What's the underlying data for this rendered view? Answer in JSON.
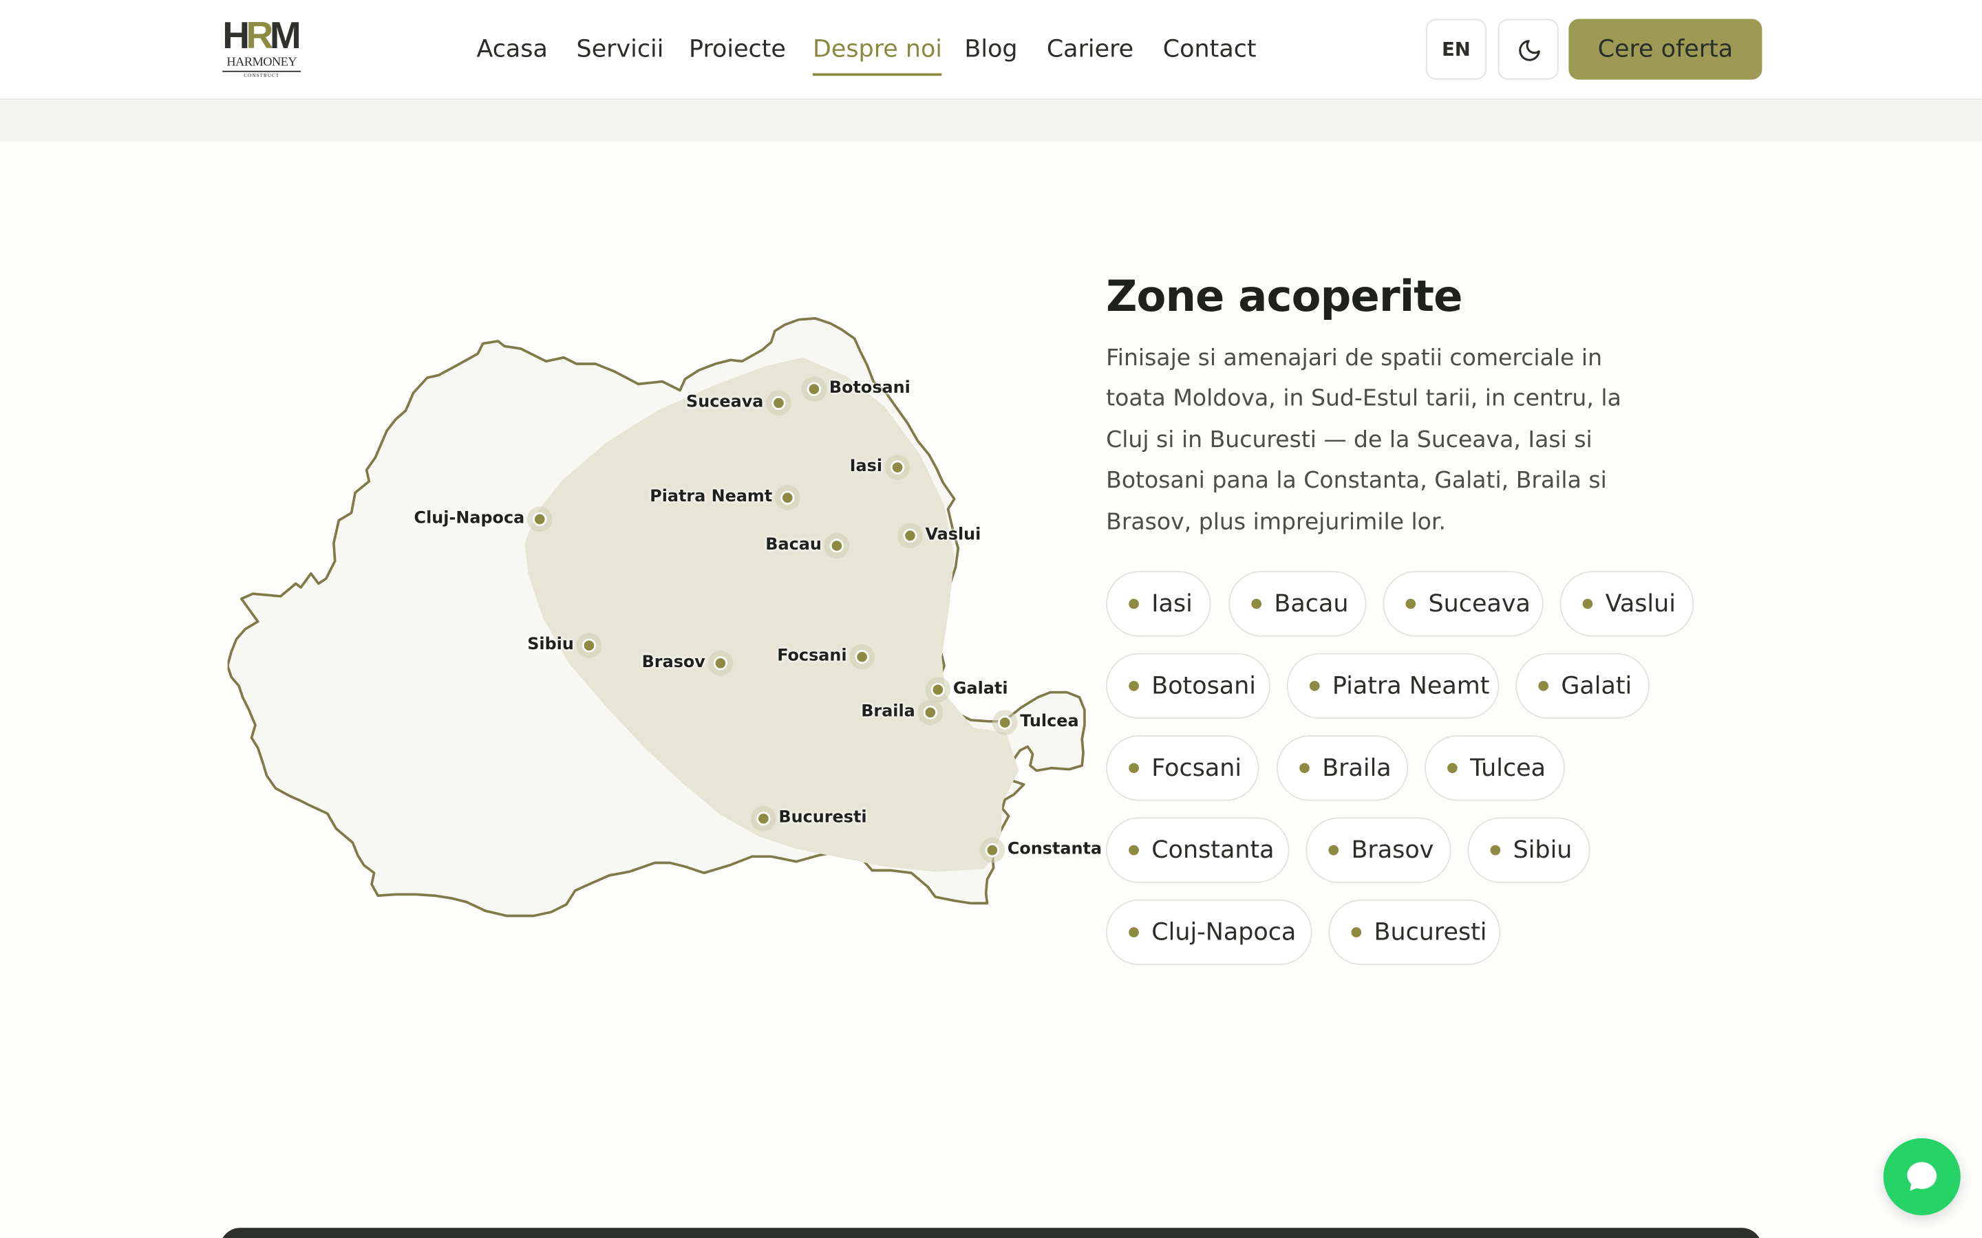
{
  "logo": {
    "mark_h": "H",
    "mark_r": "R",
    "mark_m": "M",
    "name": "HARMONEY",
    "tagline": "CONSTRUCT"
  },
  "nav": {
    "items": [
      {
        "label": "Acasa",
        "active": false
      },
      {
        "label": "Servicii",
        "active": false
      },
      {
        "label": "Proiecte",
        "active": false
      },
      {
        "label": "Despre noi",
        "active": true
      },
      {
        "label": "Blog",
        "active": false
      },
      {
        "label": "Cariere",
        "active": false
      },
      {
        "label": "Contact",
        "active": false
      }
    ],
    "lang_label": "EN",
    "theme_icon": "moon-icon",
    "cta_label": "Cere oferta"
  },
  "colors": {
    "accent": "#8a8a3f",
    "cta_bg": "#9c9a55",
    "map_fill": "#f8f8f3",
    "coverage_fill": "#e6e5d6",
    "chat": "#25d366"
  },
  "coverage": {
    "title": "Zone acoperite",
    "description": "Finisaje si amenajari de spatii comerciale in toata Moldova, in Sud-Estul tarii, in centru, la Cluj si in Bucuresti — de la Suceava, Iasi si Botosani pana la Constanta, Galati, Braila si Brasov, plus imprejurimile lor.",
    "cities": [
      "Iasi",
      "Bacau",
      "Suceava",
      "Vaslui",
      "Botosani",
      "Piatra Neamt",
      "Galati",
      "Focsani",
      "Braila",
      "Tulcea",
      "Constanta",
      "Brasov",
      "Sibiu",
      "Cluj-Napoca",
      "Bucuresti"
    ]
  },
  "map_labels": {
    "botosani": "Botosani",
    "suceava": "Suceava",
    "iasi": "Iasi",
    "piatra": "Piatra Neamt",
    "cluj": "Cluj-Napoca",
    "bacau": "Bacau",
    "vaslui": "Vaslui",
    "sibiu": "Sibiu",
    "brasov": "Brasov",
    "focsani": "Focsani",
    "galati": "Galati",
    "braila": "Braila",
    "tulcea": "Tulcea",
    "bucuresti": "Bucuresti",
    "constanta": "Constanta"
  },
  "chat": {
    "icon": "chat-bubble-icon"
  }
}
